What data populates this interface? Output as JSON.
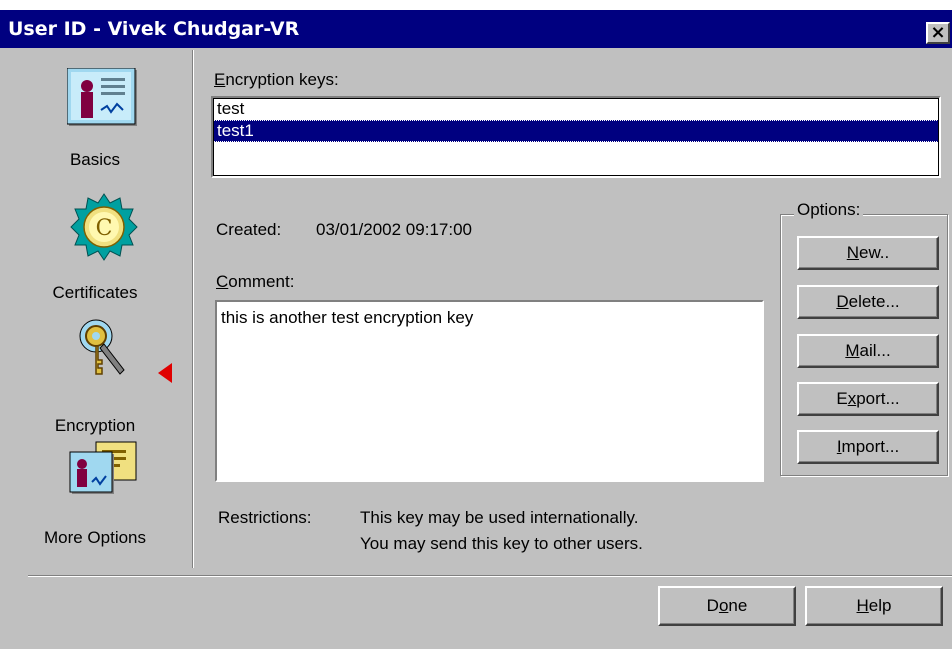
{
  "window": {
    "title": "User ID - Vivek Chudgar-VR",
    "close_label": "×"
  },
  "nav": {
    "items": [
      {
        "label": "Basics",
        "icon": "id-card-icon"
      },
      {
        "label": "Certificates",
        "icon": "certificate-seal-icon"
      },
      {
        "label": "Encryption",
        "icon": "key-icon"
      },
      {
        "label": "More Options",
        "icon": "id-cards-icon"
      }
    ],
    "selected": "Encryption",
    "indicator_color": "#e00000"
  },
  "keys": {
    "label_prefix": "",
    "label_accel": "E",
    "label_rest": "ncryption keys:",
    "items": [
      "test",
      "test1"
    ],
    "selected_item": "test1"
  },
  "created": {
    "label": "Created:",
    "value": "03/01/2002 09:17:00"
  },
  "comment": {
    "label_accel": "C",
    "label_rest": "omment:",
    "value": "this is another test encryption key"
  },
  "restrictions": {
    "label": "Restrictions:",
    "line1": "This key may be used internationally.",
    "line2": "You may send this key to other users."
  },
  "options": {
    "title": "Options:",
    "new": {
      "pre": "",
      "accel": "N",
      "post": "ew.."
    },
    "delete": {
      "pre": "",
      "accel": "D",
      "post": "elete..."
    },
    "mail": {
      "pre": "",
      "accel": "M",
      "post": "ail..."
    },
    "export": {
      "pre": "E",
      "accel": "x",
      "post": "port..."
    },
    "import": {
      "pre": "",
      "accel": "I",
      "post": "mport..."
    }
  },
  "footer": {
    "done": {
      "pre": "D",
      "accel": "o",
      "post": "ne"
    },
    "help": {
      "pre": "",
      "accel": "H",
      "post": "elp"
    }
  },
  "colors": {
    "titlebar": "#000080",
    "face": "#c0c0c0",
    "selection": "#000080"
  }
}
